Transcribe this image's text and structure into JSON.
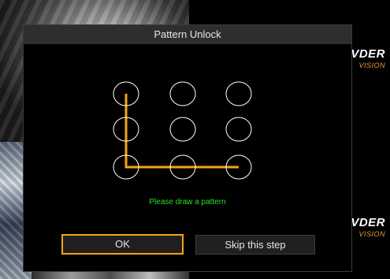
{
  "dialog": {
    "title": "Pattern Unlock",
    "hint": "Please draw a pattern",
    "ok_label": "OK",
    "skip_label": "Skip this step"
  },
  "pattern": {
    "grid_size": 3,
    "drawn_sequence": [
      0,
      3,
      6,
      7,
      8
    ]
  },
  "background": {
    "brand_text": "VDER",
    "brand_subtext": "VISION"
  },
  "colors": {
    "accent": "#f5a31c",
    "hint_text": "#27e327",
    "title_bar": "#2e2e2e",
    "brand_sub": "#e8a033"
  }
}
